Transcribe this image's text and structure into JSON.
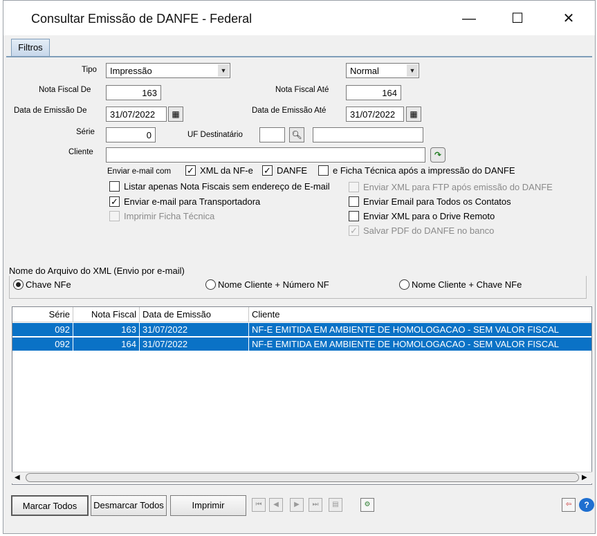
{
  "window": {
    "title": "Consultar Emissão de DANFE - Federal",
    "min": "—",
    "max": "☐",
    "close": "✕"
  },
  "tab": "Filtros",
  "form": {
    "tipo_label": "Tipo",
    "tipo_value": "Impressão",
    "modo_value": "Normal",
    "nf_de_label": "Nota Fiscal De",
    "nf_de": "163",
    "nf_ate_label": "Nota Fiscal Até",
    "nf_ate": "164",
    "data_de_label": "Data de Emissão De",
    "data_de": "31/07/2022",
    "data_ate_label": "Data de Emissão Até",
    "data_ate": "31/07/2022",
    "serie_label": "Série",
    "serie": "0",
    "uf_label": "UF Destinatário",
    "uf": "",
    "uf_nome": "",
    "cliente_label": "Cliente",
    "cliente": ""
  },
  "email": {
    "enviar_label": "Enviar e-mail com",
    "xml_nfe": "XML da NF-e",
    "danfe": "DANFE",
    "ficha": "e Ficha Técnica após a impressão do DANFE",
    "listar": "Listar apenas Nota Fiscais sem endereço de E-mail",
    "transportadora": "Enviar e-mail para Transportadora",
    "imprimir_ficha": "Imprimir Ficha Técnica",
    "ftp": "Enviar XML para FTP após emissão do DANFE",
    "todos_contatos": "Enviar Email para Todos os Contatos",
    "drive": "Enviar XML para o Drive Remoto",
    "salvar_pdf": "Salvar PDF do DANFE no banco"
  },
  "xml_name": {
    "title": "Nome do Arquivo do XML (Envio por e-mail)",
    "opt1": "Chave NFe",
    "opt2": "Nome Cliente + Número NF",
    "opt3": "Nome Cliente + Chave NFe"
  },
  "grid": {
    "headers": [
      "Série",
      "Nota Fiscal",
      "Data de Emissão",
      "Cliente"
    ],
    "rows": [
      [
        "092",
        "163",
        "31/07/2022",
        "NF-E EMITIDA EM AMBIENTE DE HOMOLOGACAO - SEM VALOR FISCAL"
      ],
      [
        "092",
        "164",
        "31/07/2022",
        "NF-E EMITIDA EM AMBIENTE DE HOMOLOGACAO - SEM VALOR FISCAL"
      ]
    ]
  },
  "buttons": {
    "marcar": "Marcar Todos",
    "desmarcar": "Desmarcar Todos",
    "imprimir": "Imprimir"
  },
  "colors": {
    "selection": "#0a72c6",
    "tab_border": "#7f9db9"
  }
}
